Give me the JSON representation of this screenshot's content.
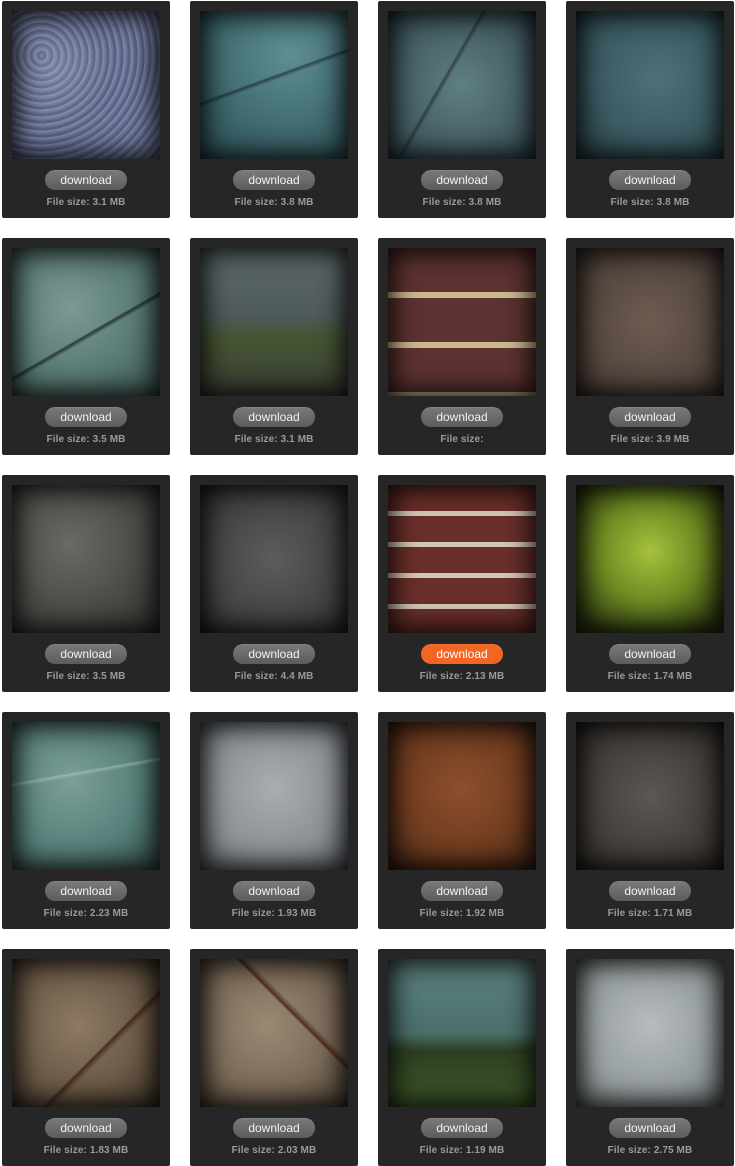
{
  "download_label": "download",
  "size_prefix": "File size:",
  "active_accent": "#f26522",
  "textures": [
    {
      "size": "3.1 MB",
      "active": false,
      "texture": "blue-gray-granite"
    },
    {
      "size": "3.8 MB",
      "active": false,
      "texture": "teal-cracked-rock"
    },
    {
      "size": "3.8 MB",
      "active": false,
      "texture": "blue-gray-cracked-rock"
    },
    {
      "size": "3.8 MB",
      "active": false,
      "texture": "slate-blue-stone"
    },
    {
      "size": "3.5 MB",
      "active": false,
      "texture": "green-gray-layered-rock"
    },
    {
      "size": "3.1 MB",
      "active": false,
      "texture": "gravel-with-grass"
    },
    {
      "size": "",
      "active": false,
      "texture": "brown-brick-wall"
    },
    {
      "size": "3.9 MB",
      "active": false,
      "texture": "brown-fine-gravel"
    },
    {
      "size": "3.5 MB",
      "active": false,
      "texture": "dark-pebbles"
    },
    {
      "size": "4.4 MB",
      "active": false,
      "texture": "dark-gray-asphalt"
    },
    {
      "size": "2.13 MB",
      "active": true,
      "texture": "red-brick-wall"
    },
    {
      "size": "1.74 MB",
      "active": false,
      "texture": "green-moss"
    },
    {
      "size": "2.23 MB",
      "active": false,
      "texture": "teal-marble"
    },
    {
      "size": "1.93 MB",
      "active": false,
      "texture": "gray-pitted-concrete"
    },
    {
      "size": "1.92 MB",
      "active": false,
      "texture": "rusty-brown-surface"
    },
    {
      "size": "1.71 MB",
      "active": false,
      "texture": "dark-rocks-gravel"
    },
    {
      "size": "1.83 MB",
      "active": false,
      "texture": "dirt-gravel-with-root"
    },
    {
      "size": "2.03 MB",
      "active": false,
      "texture": "sand-pebbles-with-root"
    },
    {
      "size": "1.19 MB",
      "active": false,
      "texture": "teal-plaster-green-moss"
    },
    {
      "size": "2.75 MB",
      "active": false,
      "texture": "light-gray-concrete"
    }
  ]
}
